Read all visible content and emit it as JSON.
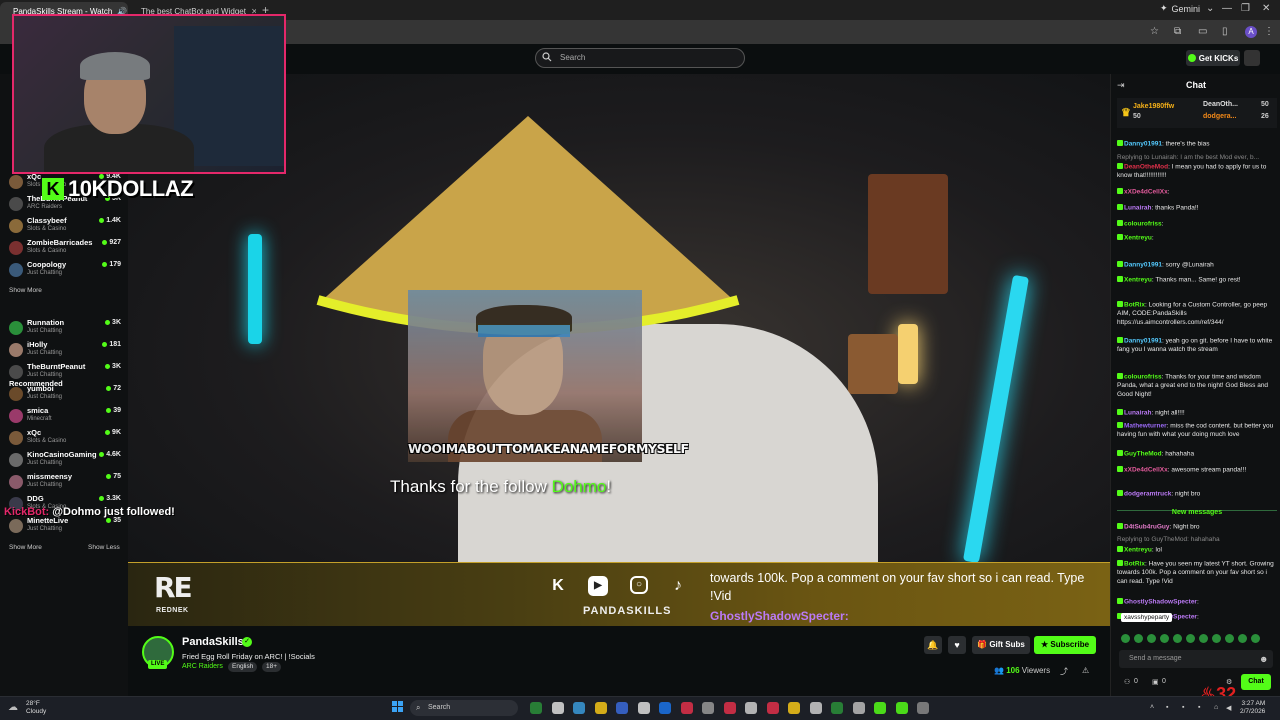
{
  "browser": {
    "tabs": [
      {
        "label": "PandaSkills Stream - Watch",
        "active": true
      },
      {
        "label": "The best ChatBot and Widget",
        "active": false
      }
    ],
    "gemini_label": "Gemini",
    "profile_initial": "A"
  },
  "header": {
    "search_placeholder": "Search",
    "get_kicks_label": "Get KICKs"
  },
  "sidebar": {
    "following": [
      {
        "name": "xQc",
        "category": "Slots & Casino",
        "viewers": "9.4K",
        "color": "#7a5a3a"
      },
      {
        "name": "TheBurnt Peanut",
        "category": "ARC Raiders",
        "viewers": "5K",
        "color": "#4a4a4a"
      },
      {
        "name": "Classybeef",
        "category": "Slots & Casino",
        "viewers": "1.4K",
        "color": "#8a6a3a"
      },
      {
        "name": "ZombieBarricades",
        "category": "Slots & Casino",
        "viewers": "927",
        "color": "#7a3030"
      },
      {
        "name": "Coopology",
        "category": "Just Chatting",
        "viewers": "179",
        "color": "#3a5a7a"
      }
    ],
    "show_more_label": "Show More",
    "recommended_title": "Recommended",
    "recommended": [
      {
        "name": "Runnation",
        "category": "Just Chatting",
        "viewers": "3K",
        "color": "#2a8f3a"
      },
      {
        "name": "iHolly",
        "category": "Just Chatting",
        "viewers": "181",
        "color": "#9a7a6a"
      },
      {
        "name": "TheBurntPeanut",
        "category": "Just Chatting",
        "viewers": "3K",
        "color": "#4a4a4a"
      },
      {
        "name": "yumboi",
        "category": "Just Chatting",
        "viewers": "72",
        "color": "#6a4a2a"
      },
      {
        "name": "smica",
        "category": "Minecraft",
        "viewers": "39",
        "color": "#9a3a6a"
      },
      {
        "name": "xQc",
        "category": "Slots & Casino",
        "viewers": "9K",
        "color": "#7a5a3a"
      },
      {
        "name": "KinoCasinoGaming",
        "category": "Just Chatting",
        "viewers": "4.6K",
        "color": "#6a6a6a"
      },
      {
        "name": "missmeensy",
        "category": "Just Chatting",
        "viewers": "75",
        "color": "#8a5a6a"
      },
      {
        "name": "DDG",
        "category": "Slots & Casino",
        "viewers": "3.3K",
        "color": "#3a3a4a"
      },
      {
        "name": "MinetteLive",
        "category": "Just Chatting",
        "viewers": "35",
        "color": "#7a6a5a"
      }
    ],
    "show_more_bottom": "Show More",
    "show_less": "Show Less"
  },
  "overlay": {
    "streamer_overlay_name": "10KDOLLAZ",
    "follow_toast_bot": "KickBot:",
    "follow_toast_text": "@Dohmo just followed!",
    "gif_caption": "WOOIMABOUTTOMAKEANAMEFORMYSELF",
    "follow_alert_prefix": "Thanks for the follow ",
    "follow_alert_user": "Dohmo",
    "follow_alert_suffix": "!",
    "brand_big": "RE",
    "brand_name": "REDNEK",
    "wordmark": "PANDASKILLS",
    "ticker_text": "towards 100k. Pop a comment on your fav short so i can read. Type !Vid",
    "ticker_chat": "GhostlyShadowSpecter:"
  },
  "stream": {
    "streamer": "PandaSkills",
    "live_badge": "LIVE",
    "title": "Fried Egg Roll Friday on ARC! | !Socials",
    "category": "ARC Raiders",
    "tags": [
      "English",
      "18+"
    ],
    "gift_subs_label": "Gift Subs",
    "subscribe_label": "Subscribe",
    "viewer_count": "106",
    "viewers_label": "Viewers"
  },
  "chat": {
    "title": "Chat",
    "leaderboard": [
      {
        "name": "Jake1980ffw",
        "value": "50"
      },
      {
        "name": "DeanOth...",
        "value": "50"
      },
      {
        "name": "dodgera...",
        "value": "26"
      }
    ],
    "messages": [
      {
        "user": "Danny01991",
        "color": "#53c8fc",
        "text": "there's the bias"
      },
      {
        "reply": "Replying to Lunairah: I am the best Mod ever, b..."
      },
      {
        "user": "DeanOtheMod",
        "color": "#e0304a",
        "text": "I mean you had to apply for us to know that!!!!!!!!!!!!"
      },
      {
        "user": "xXDe4dCellXx",
        "color": "#e05a9a",
        "text": ""
      },
      {
        "user": "Lunairah",
        "color": "#bb7af5",
        "text": "thanks Panda!!"
      },
      {
        "user": "colourofriss",
        "color": "#53fc18",
        "text": ""
      },
      {
        "user": "Xentreyu",
        "color": "#53fc18",
        "text": ""
      },
      {
        "user": "Danny01991",
        "color": "#53c8fc",
        "text": "sorry @Lunairah"
      },
      {
        "user": "Xentreyu",
        "color": "#53fc18",
        "text": "Thanks man... Same! go rest!"
      },
      {
        "user": "BotRix",
        "color": "#53fc18",
        "text": "Looking for a Custom Controller, go peep AIM, CODE:PandaSkills https://us.aimcontrollers.com/ref/344/"
      },
      {
        "user": "Danny01991",
        "color": "#53c8fc",
        "text": "yeah go on git. before I have to white fang you I wanna watch the stream"
      },
      {
        "user": "colourofriss",
        "color": "#53fc18",
        "text": "Thanks for your time and wisdom Panda, what a great end to the night! God Bless and Good Night!"
      },
      {
        "user": "Lunairah",
        "color": "#bb7af5",
        "text": "night all!!!!"
      },
      {
        "user": "Mathewturner",
        "color": "#9a6af5",
        "text": "miss the cod content. but better you having fun with what your doing much love"
      },
      {
        "user": "GuyTheMod",
        "color": "#53fc18",
        "text": "hahahaha"
      },
      {
        "user": "xXDe4dCellXx",
        "color": "#e05a9a",
        "text": "awesome stream panda!!!"
      },
      {
        "user": "dodgeramtruck",
        "color": "#bb7af5",
        "text": "night bro"
      }
    ],
    "new_messages_label": "New messages",
    "new_messages": [
      {
        "user": "D4tSub4ruGuy",
        "color": "#e07ac8",
        "text": "Night bro"
      },
      {
        "reply": "Replying to GuyTheMod: hahahaha"
      },
      {
        "user": "Xentreyu",
        "color": "#53fc18",
        "text": "lol"
      },
      {
        "user": "BotRix",
        "color": "#53fc18",
        "text": "Have you seen my latest YT short. Growing towards 100k. Pop a comment on your fav short so i can read. Type !Vid"
      },
      {
        "user": "GhostlyShadowSpecter",
        "color": "#bb7af5",
        "text": ""
      },
      {
        "user": "GhostlyShadowSpecter",
        "color": "#bb7af5",
        "text": ""
      }
    ],
    "tooltip": "xavsshypeparty",
    "input_placeholder": "Send a message",
    "send_label": "Chat",
    "footer_a": "0",
    "footer_b": "0",
    "brand_mark": "32"
  },
  "taskbar": {
    "temp": "28°F",
    "weather": "Cloudy",
    "search_label": "Search",
    "time": "3:27 AM",
    "date": "2/7/2026"
  }
}
